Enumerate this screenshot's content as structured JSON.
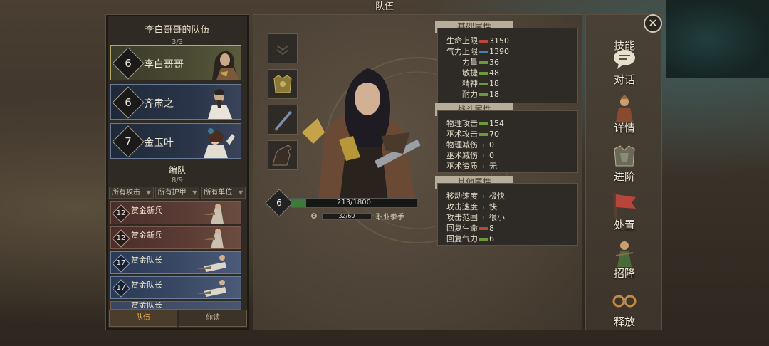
{
  "window_title": "队伍",
  "left_panel": {
    "team_title": "李白哥哥的队伍",
    "team_count": "3/3",
    "heroes": [
      {
        "level": "6",
        "name": "李白哥哥"
      },
      {
        "level": "6",
        "name": "齐肃之"
      },
      {
        "level": "7",
        "name": "金玉叶"
      }
    ],
    "squad_title": "编队",
    "squad_count": "8/9",
    "filters": [
      "所有攻击",
      "所有护甲",
      "所有单位"
    ],
    "units": [
      {
        "level": "12",
        "name": "赏金新兵"
      },
      {
        "level": "12",
        "name": "赏金新兵"
      },
      {
        "level": "17",
        "name": "赏金队长"
      },
      {
        "level": "17",
        "name": "赏金队长"
      },
      {
        "level": "",
        "name": "赏金队长"
      }
    ],
    "tabs": [
      "队伍",
      "你读"
    ]
  },
  "character": {
    "level": "6",
    "hp_text": "213/1800",
    "hp_fraction": 0.118,
    "exp_text": "32/60",
    "profession": "职业拳手"
  },
  "stats": {
    "basic_title": "基础属性",
    "basic": [
      {
        "k": "生命上限",
        "v": "3150",
        "color": "#b5493a"
      },
      {
        "k": "气力上限",
        "v": "1390",
        "color": "#4a7fb5"
      },
      {
        "k": "力量",
        "v": "36",
        "color": "#6a9a3a"
      },
      {
        "k": "敏捷",
        "v": "48",
        "color": "#6a9a3a"
      },
      {
        "k": "精神",
        "v": "18",
        "color": "#6a9a3a"
      },
      {
        "k": "耐力",
        "v": "18",
        "color": "#6a9a3a"
      }
    ],
    "combat_title": "战斗属性",
    "combat": [
      {
        "k": "物理攻击",
        "v": "154",
        "color": "#6a9a3a"
      },
      {
        "k": "巫术攻击",
        "v": "70",
        "color": "#6a9a3a"
      },
      {
        "k": "物理减伤",
        "v": "0",
        "color": ""
      },
      {
        "k": "巫术减伤",
        "v": "0",
        "color": ""
      },
      {
        "k": "巫术资质",
        "v": "无",
        "color": ""
      }
    ],
    "other_title": "其他属性",
    "other": [
      {
        "k": "移动速度",
        "v": "极快",
        "color": ""
      },
      {
        "k": "攻击速度",
        "v": "快",
        "color": ""
      },
      {
        "k": "攻击范围",
        "v": "很小",
        "color": ""
      },
      {
        "k": "回复生命",
        "v": "8",
        "color": "#b5493a"
      },
      {
        "k": "回复气力",
        "v": "6",
        "color": "#6a9a3a"
      }
    ]
  },
  "right_menu": [
    "技能",
    "对话",
    "详情",
    "进阶",
    "处置",
    "招降",
    "释放"
  ],
  "close_label": "✕"
}
